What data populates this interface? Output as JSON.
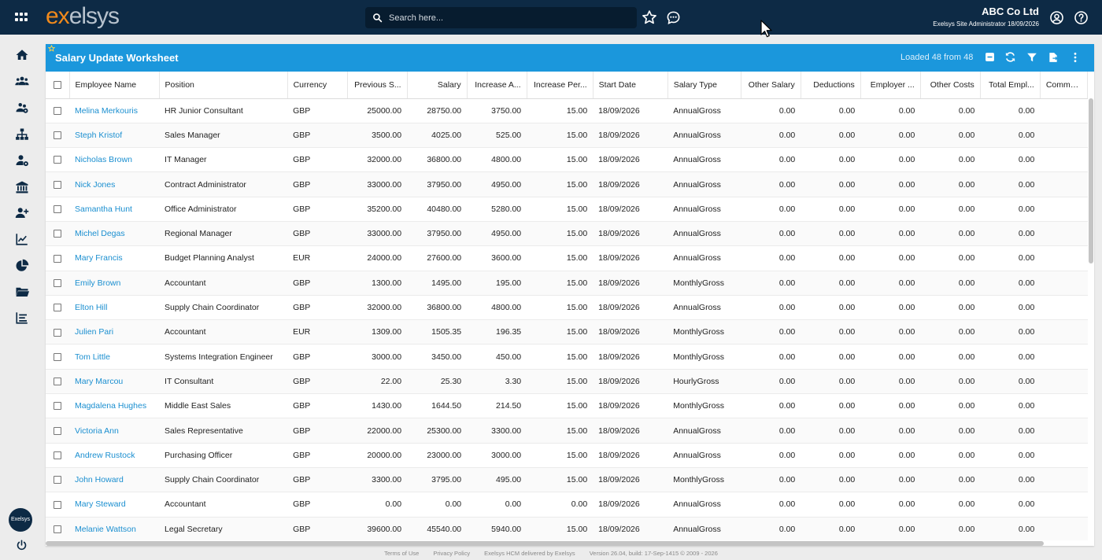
{
  "app": {
    "logo_prefix": "ex",
    "logo_rest": "elsys",
    "search_placeholder": "Search here...",
    "company": "ABC Co Ltd",
    "user_info": "Exelsys Site Administrator 18/09/2026",
    "avatar_text": "Exelsys"
  },
  "panel": {
    "title": "Salary Update Worksheet",
    "loaded": "Loaded 48 from 48"
  },
  "table": {
    "columns": [
      "Employee Name",
      "Position",
      "Currency",
      "Previous S...",
      "Salary",
      "Increase A...",
      "Increase Per...",
      "Start Date",
      "Salary Type",
      "Other Salary",
      "Deductions",
      "Employer ...",
      "Other Costs",
      "Total Empl...",
      "Comment"
    ],
    "rows": [
      [
        "Melina Merkouris",
        "HR Junior Consultant",
        "GBP",
        "25000.00",
        "28750.00",
        "3750.00",
        "15.00",
        "18/09/2026",
        "AnnualGross",
        "0.00",
        "0.00",
        "0.00",
        "0.00",
        "0.00",
        ""
      ],
      [
        "Steph Kristof",
        "Sales Manager",
        "GBP",
        "3500.00",
        "4025.00",
        "525.00",
        "15.00",
        "18/09/2026",
        "AnnualGross",
        "0.00",
        "0.00",
        "0.00",
        "0.00",
        "0.00",
        ""
      ],
      [
        "Nicholas Brown",
        "IT Manager",
        "GBP",
        "32000.00",
        "36800.00",
        "4800.00",
        "15.00",
        "18/09/2026",
        "AnnualGross",
        "0.00",
        "0.00",
        "0.00",
        "0.00",
        "0.00",
        ""
      ],
      [
        "Nick Jones",
        "Contract Administrator",
        "GBP",
        "33000.00",
        "37950.00",
        "4950.00",
        "15.00",
        "18/09/2026",
        "AnnualGross",
        "0.00",
        "0.00",
        "0.00",
        "0.00",
        "0.00",
        ""
      ],
      [
        "Samantha Hunt",
        "Office Administrator",
        "GBP",
        "35200.00",
        "40480.00",
        "5280.00",
        "15.00",
        "18/09/2026",
        "AnnualGross",
        "0.00",
        "0.00",
        "0.00",
        "0.00",
        "0.00",
        ""
      ],
      [
        "Michel Degas",
        "Regional Manager",
        "GBP",
        "33000.00",
        "37950.00",
        "4950.00",
        "15.00",
        "18/09/2026",
        "AnnualGross",
        "0.00",
        "0.00",
        "0.00",
        "0.00",
        "0.00",
        ""
      ],
      [
        "Mary Francis",
        "Budget Planning Analyst",
        "EUR",
        "24000.00",
        "27600.00",
        "3600.00",
        "15.00",
        "18/09/2026",
        "AnnualGross",
        "0.00",
        "0.00",
        "0.00",
        "0.00",
        "0.00",
        ""
      ],
      [
        "Emily Brown",
        "Accountant",
        "GBP",
        "1300.00",
        "1495.00",
        "195.00",
        "15.00",
        "18/09/2026",
        "MonthlyGross",
        "0.00",
        "0.00",
        "0.00",
        "0.00",
        "0.00",
        ""
      ],
      [
        "Elton Hill",
        "Supply Chain Coordinator",
        "GBP",
        "32000.00",
        "36800.00",
        "4800.00",
        "15.00",
        "18/09/2026",
        "AnnualGross",
        "0.00",
        "0.00",
        "0.00",
        "0.00",
        "0.00",
        ""
      ],
      [
        "Julien Pari",
        "Accountant",
        "EUR",
        "1309.00",
        "1505.35",
        "196.35",
        "15.00",
        "18/09/2026",
        "MonthlyGross",
        "0.00",
        "0.00",
        "0.00",
        "0.00",
        "0.00",
        ""
      ],
      [
        "Tom Little",
        "Systems Integration Engineer",
        "GBP",
        "3000.00",
        "3450.00",
        "450.00",
        "15.00",
        "18/09/2026",
        "MonthlyGross",
        "0.00",
        "0.00",
        "0.00",
        "0.00",
        "0.00",
        ""
      ],
      [
        "Mary Marcou",
        "IT Consultant",
        "GBP",
        "22.00",
        "25.30",
        "3.30",
        "15.00",
        "18/09/2026",
        "HourlyGross",
        "0.00",
        "0.00",
        "0.00",
        "0.00",
        "0.00",
        ""
      ],
      [
        "Magdalena Hughes",
        "Middle East Sales",
        "GBP",
        "1430.00",
        "1644.50",
        "214.50",
        "15.00",
        "18/09/2026",
        "MonthlyGross",
        "0.00",
        "0.00",
        "0.00",
        "0.00",
        "0.00",
        ""
      ],
      [
        "Victoria Ann",
        "Sales Representative",
        "GBP",
        "22000.00",
        "25300.00",
        "3300.00",
        "15.00",
        "18/09/2026",
        "AnnualGross",
        "0.00",
        "0.00",
        "0.00",
        "0.00",
        "0.00",
        ""
      ],
      [
        "Andrew Rustock",
        "Purchasing Officer",
        "GBP",
        "20000.00",
        "23000.00",
        "3000.00",
        "15.00",
        "18/09/2026",
        "AnnualGross",
        "0.00",
        "0.00",
        "0.00",
        "0.00",
        "0.00",
        ""
      ],
      [
        "John Howard",
        "Supply Chain Coordinator",
        "GBP",
        "3300.00",
        "3795.00",
        "495.00",
        "15.00",
        "18/09/2026",
        "MonthlyGross",
        "0.00",
        "0.00",
        "0.00",
        "0.00",
        "0.00",
        ""
      ],
      [
        "Mary Steward",
        "Accountant",
        "GBP",
        "0.00",
        "0.00",
        "0.00",
        "0.00",
        "18/09/2026",
        "AnnualGross",
        "0.00",
        "0.00",
        "0.00",
        "0.00",
        "0.00",
        ""
      ],
      [
        "Melanie Wattson",
        "Legal Secretary",
        "GBP",
        "39600.00",
        "45540.00",
        "5940.00",
        "15.00",
        "18/09/2026",
        "AnnualGross",
        "0.00",
        "0.00",
        "0.00",
        "0.00",
        "0.00",
        ""
      ]
    ]
  },
  "footer": {
    "terms": "Terms of Use",
    "privacy": "Privacy Policy",
    "delivered": "Exelsys HCM delivered by Exelsys",
    "version": "Version 26.04, build: 17-Sep-1415 © 2009 - 2026"
  },
  "colors": {
    "topbar": "#0d2a45",
    "panel_header": "#1b97dc",
    "link": "#1b8fd0",
    "logo_accent": "#f08a1c"
  },
  "icons": {
    "sidebar": [
      "home-icon",
      "team-icon",
      "groups-icon",
      "org-chart-icon",
      "user-settings-icon",
      "bank-icon",
      "add-user-icon",
      "line-chart-icon",
      "pie-chart-icon",
      "folder-icon",
      "list-chart-icon"
    ],
    "header": [
      "collapse-icon",
      "refresh-icon",
      "filter-icon",
      "export-icon",
      "more-vertical-icon"
    ]
  }
}
